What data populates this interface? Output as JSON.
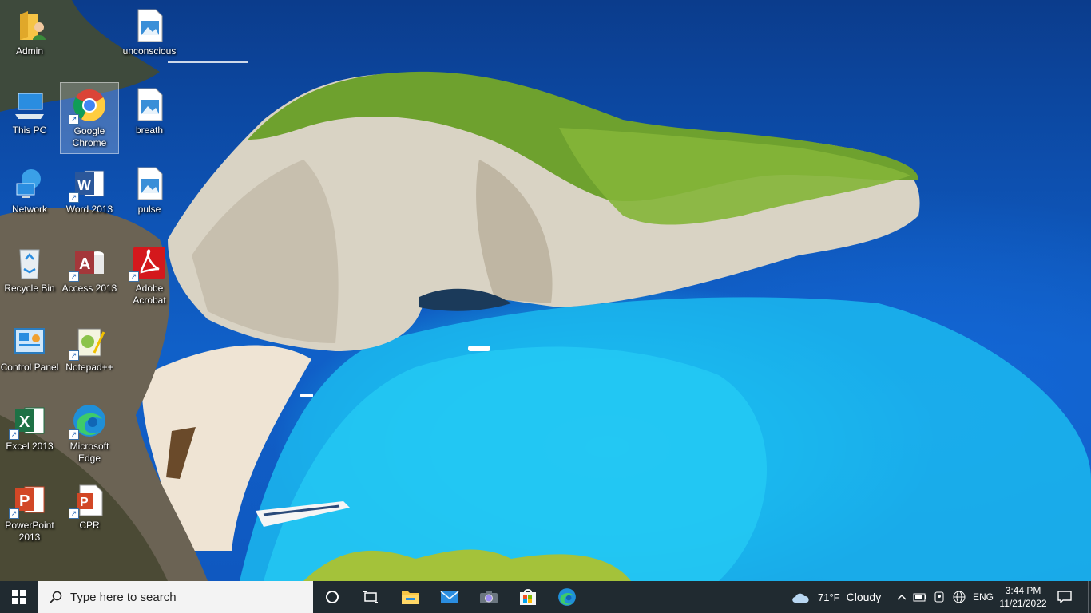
{
  "desktop": {
    "icons": [
      {
        "label": "Admin",
        "icon": "user-folder-icon"
      },
      {
        "label": "unconscious",
        "icon": "image-file-icon"
      },
      {
        "label": "This PC",
        "icon": "computer-icon"
      },
      {
        "label": "Google Chrome",
        "icon": "chrome-icon"
      },
      {
        "label": "breath",
        "icon": "image-file-icon"
      },
      {
        "label": "Network",
        "icon": "network-icon"
      },
      {
        "label": "Word 2013",
        "icon": "word-icon"
      },
      {
        "label": "pulse",
        "icon": "image-file-icon"
      },
      {
        "label": "Recycle Bin",
        "icon": "recycle-bin-icon"
      },
      {
        "label": "Access 2013",
        "icon": "access-icon"
      },
      {
        "label": "Adobe Acrobat",
        "icon": "acrobat-icon"
      },
      {
        "label": "Control Panel",
        "icon": "control-panel-icon"
      },
      {
        "label": "Notepad++",
        "icon": "notepad-plus-plus-icon"
      },
      {
        "label": "Excel 2013",
        "icon": "excel-icon"
      },
      {
        "label": "Microsoft Edge",
        "icon": "edge-icon"
      },
      {
        "label": "PowerPoint 2013",
        "icon": "powerpoint-icon"
      },
      {
        "label": "CPR",
        "icon": "powerpoint-file-icon"
      }
    ]
  },
  "taskbar": {
    "search_placeholder": "Type here to search",
    "pinned": [
      "cortana-icon",
      "task-view-icon",
      "file-explorer-icon",
      "mail-icon",
      "camera-icon",
      "store-icon",
      "edge-icon"
    ],
    "weather": {
      "temp": "71°F",
      "condition": "Cloudy"
    },
    "language": "ENG",
    "time": "3:44 PM",
    "date": "11/21/2022"
  },
  "colors": {
    "taskbar": "#202a30",
    "accent": "#0078d7"
  }
}
